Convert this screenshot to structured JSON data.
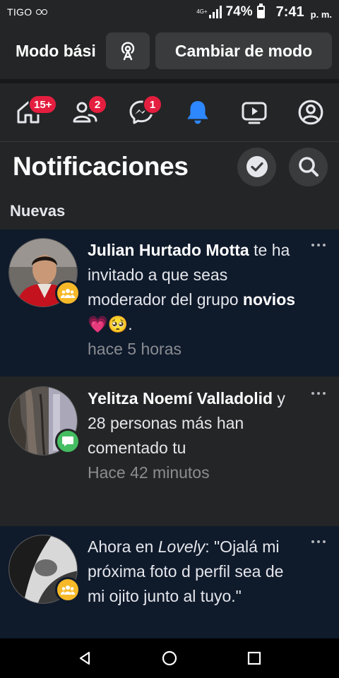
{
  "status_bar": {
    "carrier": "TIGO",
    "network": "4G+",
    "battery_percent": "74%",
    "battery_level": 0.74,
    "time": "7:41",
    "ampm": "p. m."
  },
  "mode_bar": {
    "title": "Modo bási",
    "switch_label": "Cambiar de modo"
  },
  "tabs": [
    {
      "icon": "home-icon",
      "badge": "15+"
    },
    {
      "icon": "friends-icon",
      "badge": "2"
    },
    {
      "icon": "messenger-icon",
      "badge": "1"
    },
    {
      "icon": "bell-icon",
      "badge": "",
      "active": true
    },
    {
      "icon": "watch-icon",
      "badge": ""
    },
    {
      "icon": "profile-circle-icon",
      "badge": ""
    }
  ],
  "header": {
    "title": "Notificaciones"
  },
  "section": {
    "label": "Nuevas"
  },
  "notifications": [
    {
      "name": "Julian Hurtado Motta",
      "text1": " te ha invitado a que seas moderador del grupo ",
      "group": "novios",
      "emoji": " 💗🥺.",
      "time": "hace 5 horas",
      "badge_icon": "group-icon",
      "unread": true
    },
    {
      "name1": "Yelitza Noemí Valladolid",
      "text1": " y 28 personas más han comentado tu",
      "time": "Hace 42 minutos",
      "badge_icon": "comment-icon",
      "unread": false
    },
    {
      "prefix": "Ahora en ",
      "group": "Lovely",
      "text1": ": \"Ojalá mi próxima foto d perfil sea de mi ojito junto al tuyo.\"",
      "badge_icon": "group-icon",
      "unread": true
    }
  ],
  "colors": {
    "accent": "#2d88ff",
    "badge_red": "#e41e3f",
    "unread_bg": "#0f1a2b",
    "group_badge": "#f7b928",
    "comment_badge": "#45bd62"
  }
}
